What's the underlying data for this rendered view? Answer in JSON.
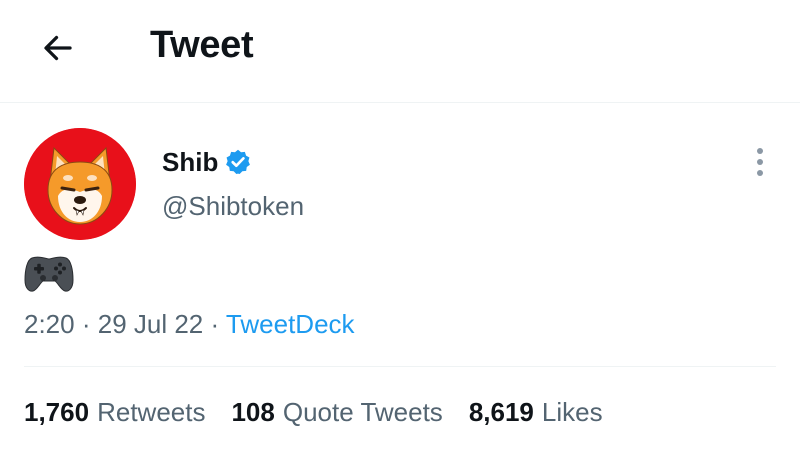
{
  "header": {
    "title": "Tweet",
    "back_icon": "arrow-left-icon"
  },
  "tweet": {
    "author": {
      "name": "Shib",
      "handle": "@Shibtoken",
      "verified": true,
      "avatar_icon": "shiba-inu-avatar",
      "avatar_bg": "#e8101a"
    },
    "body_emoji": "video-game-controller-emoji",
    "meta": {
      "time": "2:20",
      "separator": "·",
      "date": "29 Jul 22",
      "source": "TweetDeck"
    },
    "stats": [
      {
        "count": "1,760",
        "label": "Retweets"
      },
      {
        "count": "108",
        "label": "Quote Tweets"
      },
      {
        "count": "8,619",
        "label": "Likes"
      }
    ]
  },
  "colors": {
    "text_primary": "#0f1419",
    "text_secondary": "#536471",
    "link": "#1d9bf0",
    "verified": "#1d9bf0",
    "divider": "#eff3f4"
  }
}
